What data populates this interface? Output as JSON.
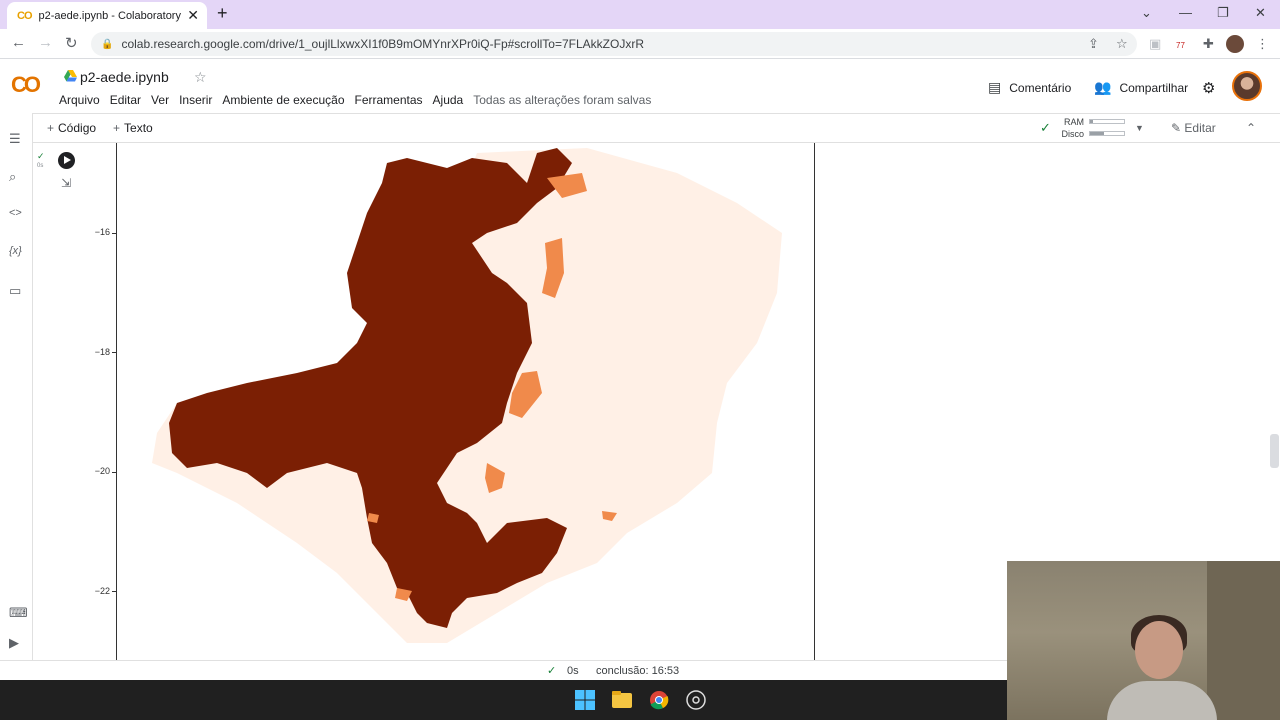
{
  "browser": {
    "tab_title": "p2-aede.ipynb - Colaboratory",
    "favicon": "CO",
    "url": "colab.research.google.com/drive/1_oujlLlxwxXI1f0B9mOMYnrXPr0iQ-Fp#scrollTo=7FLAkkZOJxrR",
    "extension_badge": "77"
  },
  "colab": {
    "logo": "CO",
    "notebook_title": "p2-aede.ipynb",
    "menu": [
      "Arquivo",
      "Editar",
      "Ver",
      "Inserir",
      "Ambiente de execução",
      "Ferramentas",
      "Ajuda"
    ],
    "saved_status": "Todas as alterações foram salvas",
    "comment_label": "Comentário",
    "share_label": "Compartilhar"
  },
  "toolbar": {
    "code_label": "Código",
    "text_label": "Texto",
    "ram_label": "RAM",
    "disk_label": "Disco",
    "ram_level": 0.1,
    "disk_level": 0.4,
    "edit_label": "Editar"
  },
  "cell": {
    "exec_time_small": "0s"
  },
  "chart_data": {
    "type": "choropleth",
    "ytick_labels": [
      "−16",
      "−18",
      "−20",
      "−22"
    ],
    "yticks": [
      -16,
      -18,
      -20,
      -22
    ],
    "colors": {
      "high": "#7b1f04",
      "medium": "#f08a4b",
      "low": "#fff0e6"
    }
  },
  "status": {
    "time": "0s",
    "completion": "conclusão: 16:53"
  }
}
